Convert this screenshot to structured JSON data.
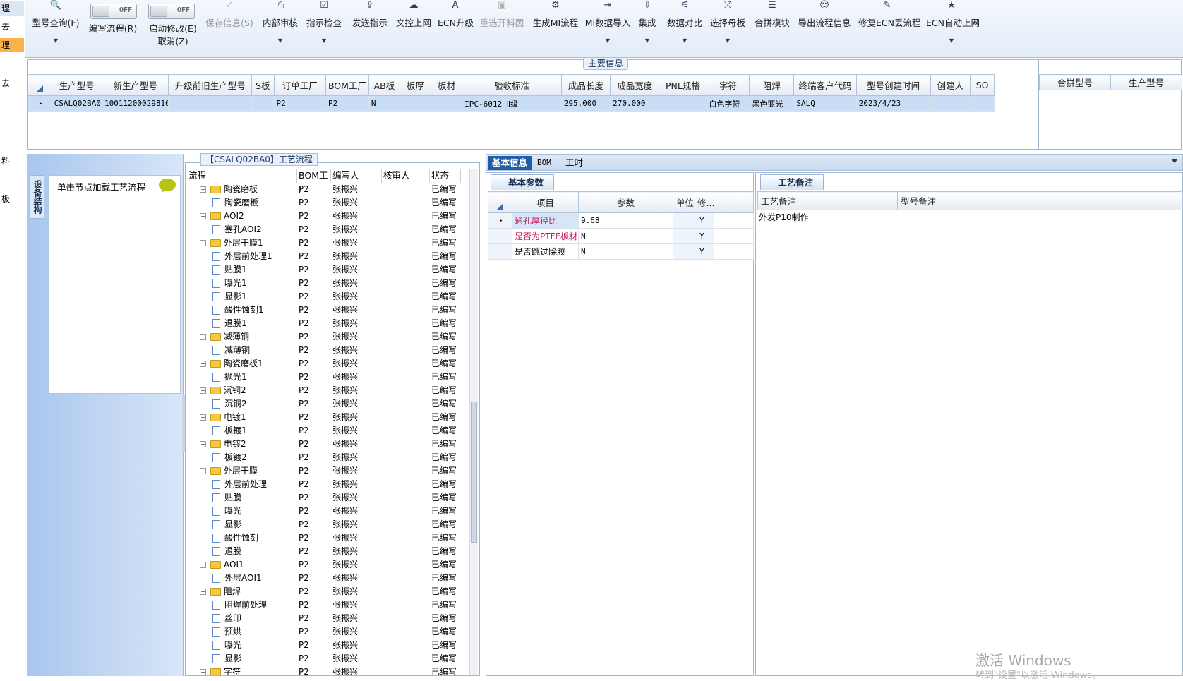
{
  "left_strip": [
    "理",
    "去",
    "理",
    "去",
    "料",
    "板"
  ],
  "toolbar": {
    "buttons": [
      {
        "label": "型号查询(F)",
        "icon": "search-icon",
        "dropdown": true,
        "disabled": false
      },
      {
        "label": "编写流程(R)",
        "icon": "toggle",
        "dropdown": false,
        "disabled": false,
        "toggle": "OFF"
      },
      {
        "label": "启动修改(E)",
        "sub": "取消(Z)",
        "icon": "toggle",
        "dropdown": false,
        "disabled": false,
        "toggle": "OFF"
      },
      {
        "label": "保存信息(S)",
        "icon": "check-icon",
        "dropdown": false,
        "disabled": true
      },
      {
        "label": "内部审核",
        "icon": "printer-icon",
        "dropdown": true,
        "disabled": false
      },
      {
        "label": "指示检查",
        "icon": "checkbox-icon",
        "dropdown": true,
        "disabled": false
      },
      {
        "label": "发送指示",
        "icon": "upload-icon",
        "dropdown": false,
        "disabled": false
      },
      {
        "label": "文控上网",
        "icon": "cloud-upload-icon",
        "dropdown": false,
        "disabled": false
      },
      {
        "label": "ECN升级",
        "icon": "letter-a-icon",
        "dropdown": false,
        "disabled": false
      },
      {
        "label": "重选开料图",
        "icon": "image-icon",
        "dropdown": false,
        "disabled": true
      },
      {
        "label": "生成MI流程",
        "icon": "gears-icon",
        "dropdown": false,
        "disabled": false
      },
      {
        "label": "MI数据导入",
        "icon": "import-icon",
        "dropdown": true,
        "disabled": false
      },
      {
        "label": "集成",
        "icon": "download-icon",
        "dropdown": true,
        "disabled": false
      },
      {
        "label": "数据对比",
        "icon": "compare-icon",
        "dropdown": true,
        "disabled": false
      },
      {
        "label": "选择母板",
        "icon": "shuffle-icon",
        "dropdown": true,
        "disabled": false
      },
      {
        "label": "合拼模块",
        "icon": "list-icon",
        "dropdown": false,
        "disabled": false
      },
      {
        "label": "导出流程信息",
        "icon": "smile-icon",
        "dropdown": false,
        "disabled": false
      },
      {
        "label": "修复ECN丢流程",
        "icon": "wrench-icon",
        "dropdown": false,
        "disabled": false
      },
      {
        "label": "ECN自动上网",
        "icon": "star-icon",
        "dropdown": true,
        "disabled": false
      }
    ]
  },
  "main_info": {
    "caption": "主要信息",
    "columns": [
      "生产型号",
      "新生产型号",
      "升级前旧生产型号",
      "S板",
      "订单工厂",
      "BOM工厂",
      "AB板",
      "板厚",
      "板材",
      "验收标准",
      "成品长度",
      "成品宽度",
      "PNL规格",
      "字符",
      "阻焊",
      "终端客户代码",
      "型号创建时间",
      "创建人",
      "SO"
    ],
    "row": [
      "CSALQ02BA0",
      "10011200029816",
      "",
      "",
      "P2",
      "P2",
      "N",
      "",
      "",
      "IPC-6012 Ⅱ级",
      "295.000",
      "270.000",
      "",
      "白色字符",
      "黑色亚光",
      "SALQ",
      "2023/4/23",
      "",
      ""
    ],
    "side_columns": [
      "合拼型号",
      "生产型号"
    ]
  },
  "left_panel": {
    "vertical_tab": "设备结构",
    "hint": "单击节点加载工艺流程"
  },
  "tree": {
    "caption": "【CSALQ02BA0】工艺流程",
    "columns": [
      "流程",
      "BOM工厂",
      "编写人",
      "核审人",
      "状态"
    ],
    "rows": [
      {
        "name": "陶瓷磨板",
        "type": "folder",
        "bom": "P2",
        "writer": "张振兴",
        "status": "已编写"
      },
      {
        "name": "陶瓷磨板",
        "type": "doc",
        "bom": "P2",
        "writer": "张振兴",
        "status": "已编写"
      },
      {
        "name": "AOI2",
        "type": "folder",
        "bom": "P2",
        "writer": "张振兴",
        "status": "已编写"
      },
      {
        "name": "塞孔AOI2",
        "type": "doc",
        "bom": "P2",
        "writer": "张振兴",
        "status": "已编写"
      },
      {
        "name": "外层干膜1",
        "type": "folder",
        "bom": "P2",
        "writer": "张振兴",
        "status": "已编写"
      },
      {
        "name": "外层前处理1",
        "type": "doc",
        "bom": "P2",
        "writer": "张振兴",
        "status": "已编写"
      },
      {
        "name": "贴膜1",
        "type": "doc",
        "bom": "P2",
        "writer": "张振兴",
        "status": "已编写"
      },
      {
        "name": "曝光1",
        "type": "doc",
        "bom": "P2",
        "writer": "张振兴",
        "status": "已编写"
      },
      {
        "name": "显影1",
        "type": "doc",
        "bom": "P2",
        "writer": "张振兴",
        "status": "已编写"
      },
      {
        "name": "酸性蚀刻1",
        "type": "doc",
        "bom": "P2",
        "writer": "张振兴",
        "status": "已编写"
      },
      {
        "name": "退膜1",
        "type": "doc",
        "bom": "P2",
        "writer": "张振兴",
        "status": "已编写"
      },
      {
        "name": "减薄铜",
        "type": "folder",
        "bom": "P2",
        "writer": "张振兴",
        "status": "已编写"
      },
      {
        "name": "减薄铜",
        "type": "doc",
        "bom": "P2",
        "writer": "张振兴",
        "status": "已编写"
      },
      {
        "name": "陶瓷磨板1",
        "type": "folder",
        "bom": "P2",
        "writer": "张振兴",
        "status": "已编写"
      },
      {
        "name": "抛光1",
        "type": "doc",
        "bom": "P2",
        "writer": "张振兴",
        "status": "已编写"
      },
      {
        "name": "沉铜2",
        "type": "folder",
        "bom": "P2",
        "writer": "张振兴",
        "status": "已编写"
      },
      {
        "name": "沉铜2",
        "type": "doc",
        "bom": "P2",
        "writer": "张振兴",
        "status": "已编写"
      },
      {
        "name": "电镀1",
        "type": "folder",
        "bom": "P2",
        "writer": "张振兴",
        "status": "已编写"
      },
      {
        "name": "板镀1",
        "type": "doc",
        "bom": "P2",
        "writer": "张振兴",
        "status": "已编写"
      },
      {
        "name": "电镀2",
        "type": "folder",
        "bom": "P2",
        "writer": "张振兴",
        "status": "已编写"
      },
      {
        "name": "板镀2",
        "type": "doc",
        "bom": "P2",
        "writer": "张振兴",
        "status": "已编写"
      },
      {
        "name": "外层干膜",
        "type": "folder",
        "bom": "P2",
        "writer": "张振兴",
        "status": "已编写"
      },
      {
        "name": "外层前处理",
        "type": "doc",
        "bom": "P2",
        "writer": "张振兴",
        "status": "已编写"
      },
      {
        "name": "贴膜",
        "type": "doc",
        "bom": "P2",
        "writer": "张振兴",
        "status": "已编写"
      },
      {
        "name": "曝光",
        "type": "doc",
        "bom": "P2",
        "writer": "张振兴",
        "status": "已编写"
      },
      {
        "name": "显影",
        "type": "doc",
        "bom": "P2",
        "writer": "张振兴",
        "status": "已编写"
      },
      {
        "name": "酸性蚀刻",
        "type": "doc",
        "bom": "P2",
        "writer": "张振兴",
        "status": "已编写"
      },
      {
        "name": "退膜",
        "type": "doc",
        "bom": "P2",
        "writer": "张振兴",
        "status": "已编写"
      },
      {
        "name": "AOI1",
        "type": "folder",
        "bom": "P2",
        "writer": "张振兴",
        "status": "已编写"
      },
      {
        "name": "外层AOI1",
        "type": "doc",
        "bom": "P2",
        "writer": "张振兴",
        "status": "已编写"
      },
      {
        "name": "阻焊",
        "type": "folder",
        "bom": "P2",
        "writer": "张振兴",
        "status": "已编写"
      },
      {
        "name": "阻焊前处理",
        "type": "doc",
        "bom": "P2",
        "writer": "张振兴",
        "status": "已编写"
      },
      {
        "name": "丝印",
        "type": "doc",
        "bom": "P2",
        "writer": "张振兴",
        "status": "已编写"
      },
      {
        "name": "预烘",
        "type": "doc",
        "bom": "P2",
        "writer": "张振兴",
        "status": "已编写"
      },
      {
        "name": "曝光",
        "type": "doc",
        "bom": "P2",
        "writer": "张振兴",
        "status": "已编写"
      },
      {
        "name": "显影",
        "type": "doc",
        "bom": "P2",
        "writer": "张振兴",
        "status": "已编写"
      },
      {
        "name": "字符",
        "type": "folder",
        "bom": "P2",
        "writer": "张振兴",
        "status": "已编写"
      }
    ]
  },
  "right": {
    "tabs": [
      "基本信息",
      "BOM",
      "工时"
    ],
    "params_tab": "基本参数",
    "params_columns": [
      "项目",
      "参数",
      "单位",
      "修..."
    ],
    "params": [
      {
        "item": "通孔厚径比",
        "value": "9.68",
        "unit": "",
        "mod": "Y",
        "highlight": true
      },
      {
        "item": "是否为PTFE板材",
        "value": "N",
        "unit": "",
        "mod": "Y",
        "highlight": true
      },
      {
        "item": "是否跳过除胶",
        "value": "N",
        "unit": "",
        "mod": "Y",
        "highlight": false
      }
    ],
    "notes_tab": "工艺备注",
    "notes_columns": [
      "工艺备注",
      "型号备注"
    ],
    "process_note": "外发P10制作"
  },
  "watermark": {
    "line1": "激活 Windows",
    "line2": "转到\"设置\"以激活 Windows。"
  }
}
